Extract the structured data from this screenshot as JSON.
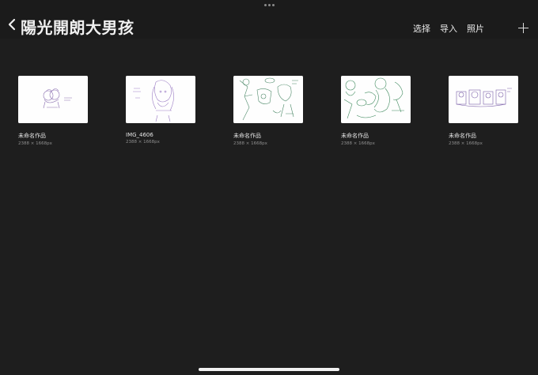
{
  "header": {
    "title": "陽光開朗大男孩",
    "actions": [
      "选择",
      "导入",
      "照片"
    ]
  },
  "artworks": [
    {
      "name": "未命名作品",
      "size": "2388 × 1668px",
      "ink": "#8a6fb0"
    },
    {
      "name": "IMG_4606",
      "size": "2388 × 1668px",
      "ink": "#9b7cc4"
    },
    {
      "name": "未命名作品",
      "size": "2388 × 1668px",
      "ink": "#4e8a6a"
    },
    {
      "name": "未命名作品",
      "size": "2388 × 1668px",
      "ink": "#3f8a5e"
    },
    {
      "name": "未命名作品",
      "size": "2388 × 1668px",
      "ink": "#7a5ea8"
    }
  ],
  "colors": {
    "background": "#1e1e1e",
    "header": "#1b1b1b"
  },
  "icons": {
    "back": "chevron-left-icon",
    "add": "plus-icon"
  }
}
